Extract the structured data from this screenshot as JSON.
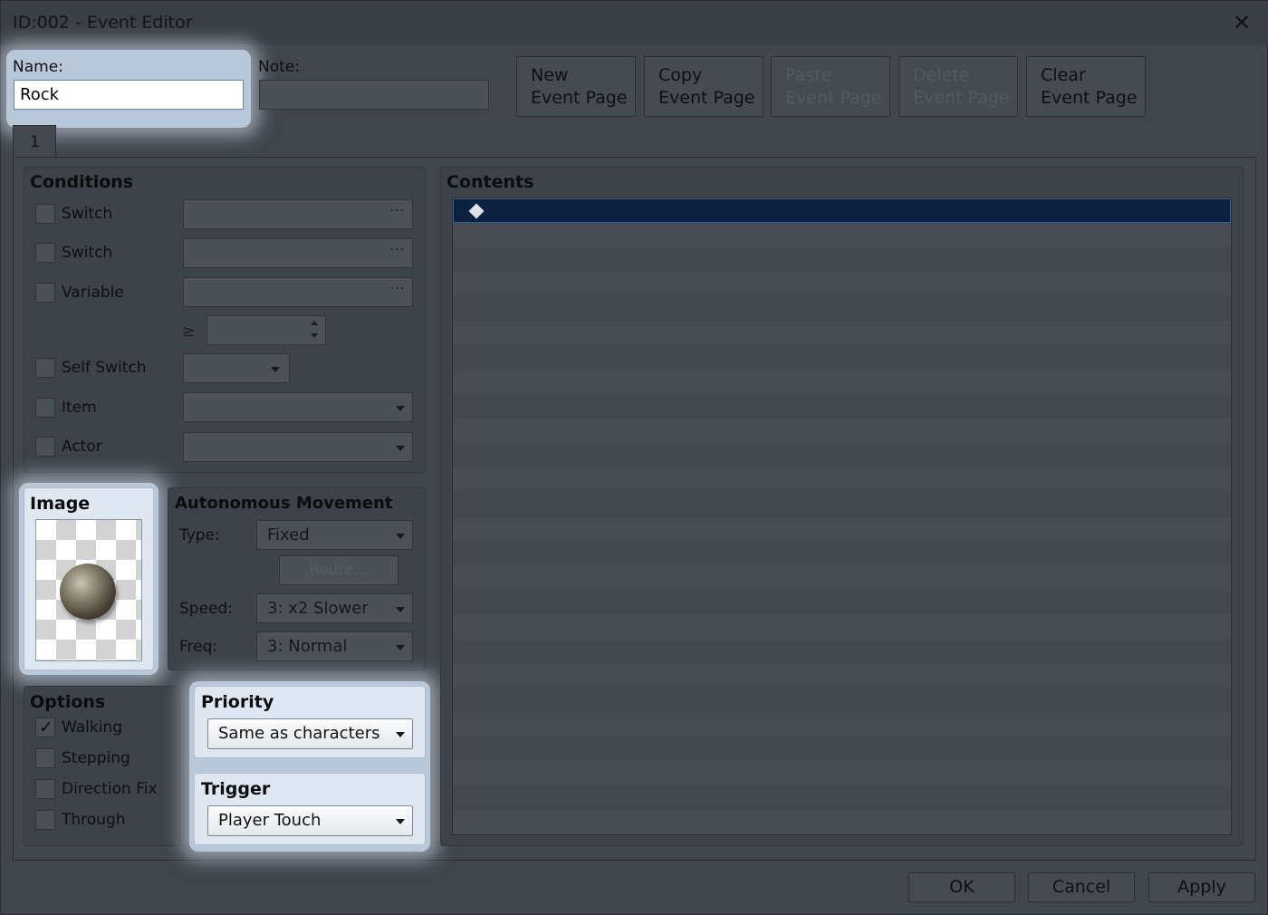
{
  "window": {
    "title": "ID:002 - Event Editor",
    "close_icon": "close-icon"
  },
  "name_field": {
    "label": "Name:",
    "value": "Rock"
  },
  "note_field": {
    "label": "Note:",
    "value": ""
  },
  "page_buttons": [
    {
      "line1": "New",
      "line2": "Event Page",
      "enabled": true
    },
    {
      "line1": "Copy",
      "line2": "Event Page",
      "enabled": true
    },
    {
      "line1": "Paste",
      "line2": "Event Page",
      "enabled": false
    },
    {
      "line1": "Delete",
      "line2": "Event Page",
      "enabled": false
    },
    {
      "line1": "Clear",
      "line2": "Event Page",
      "enabled": true
    }
  ],
  "tabs": [
    {
      "label": "1"
    }
  ],
  "conditions": {
    "title": "Conditions",
    "switch1_label": "Switch",
    "switch2_label": "Switch",
    "variable_label": "Variable",
    "gte_symbol": "≥",
    "self_switch_label": "Self Switch",
    "item_label": "Item",
    "actor_label": "Actor",
    "more_button": "···"
  },
  "image": {
    "title": "Image",
    "sprite": "rock-sprite"
  },
  "autonomous_movement": {
    "title": "Autonomous Movement",
    "type_label": "Type:",
    "type_value": "Fixed",
    "route_button": "Route...",
    "speed_label": "Speed:",
    "speed_value": "3: x2 Slower",
    "freq_label": "Freq:",
    "freq_value": "3: Normal"
  },
  "options": {
    "title": "Options",
    "items": [
      {
        "label": "Walking",
        "checked": true
      },
      {
        "label": "Stepping",
        "checked": false
      },
      {
        "label": "Direction Fix",
        "checked": false
      },
      {
        "label": "Through",
        "checked": false
      }
    ]
  },
  "priority": {
    "title": "Priority",
    "value": "Same as characters"
  },
  "trigger": {
    "title": "Trigger",
    "value": "Player Touch"
  },
  "contents": {
    "title": "Contents",
    "first_line_icon": "diamond-icon"
  },
  "footer": {
    "ok": "OK",
    "cancel": "Cancel",
    "apply": "Apply"
  },
  "colors": {
    "highlight": "#dfe8f2",
    "selection": "#0b2142",
    "dim_bg": "#41464d"
  }
}
